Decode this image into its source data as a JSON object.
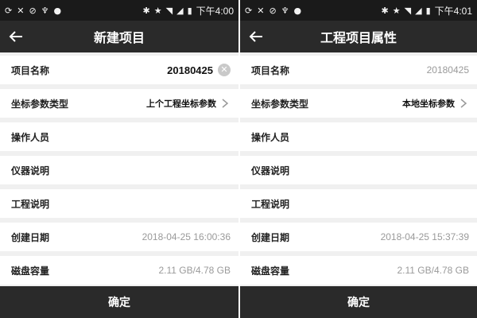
{
  "left": {
    "status": {
      "time": "下午4:00"
    },
    "title": "新建项目",
    "fields": {
      "project_name": {
        "label": "项目名称",
        "value": "20180425"
      },
      "coord_type": {
        "label": "坐标参数类型",
        "value": "上个工程坐标参数"
      },
      "operator": {
        "label": "操作人员",
        "value": ""
      },
      "instrument": {
        "label": "仪器说明",
        "value": ""
      },
      "project_desc": {
        "label": "工程说明",
        "value": ""
      },
      "created": {
        "label": "创建日期",
        "value": "2018-04-25 16:00:36"
      },
      "disk": {
        "label": "磁盘容量",
        "value": "2.11 GB/4.78 GB"
      }
    },
    "confirm_label": "确定"
  },
  "right": {
    "status": {
      "time": "下午4:01"
    },
    "title": "工程项目属性",
    "fields": {
      "project_name": {
        "label": "项目名称",
        "value": "20180425"
      },
      "coord_type": {
        "label": "坐标参数类型",
        "value": "本地坐标参数"
      },
      "operator": {
        "label": "操作人员",
        "value": ""
      },
      "instrument": {
        "label": "仪器说明",
        "value": ""
      },
      "project_desc": {
        "label": "工程说明",
        "value": ""
      },
      "created": {
        "label": "创建日期",
        "value": "2018-04-25 15:37:39"
      },
      "disk": {
        "label": "磁盘容量",
        "value": "2.11 GB/4.78 GB"
      }
    },
    "confirm_label": "确定"
  },
  "icons": {
    "status_left": [
      "sync-icon",
      "mute-icon",
      "signal-off-icon",
      "usb-icon",
      "location-icon"
    ],
    "status_right": [
      "bluetooth-icon",
      "star-icon",
      "wifi-icon",
      "cell-signal-icon",
      "battery-icon"
    ],
    "back": "back-arrow-icon",
    "chevron": "chevron-right-icon",
    "clear": "clear-icon"
  },
  "colors": {
    "bar": "#2a2a2a",
    "status": "#1a1a1a",
    "background": "#f0f0f0",
    "muted_text": "#9a9a9a"
  }
}
